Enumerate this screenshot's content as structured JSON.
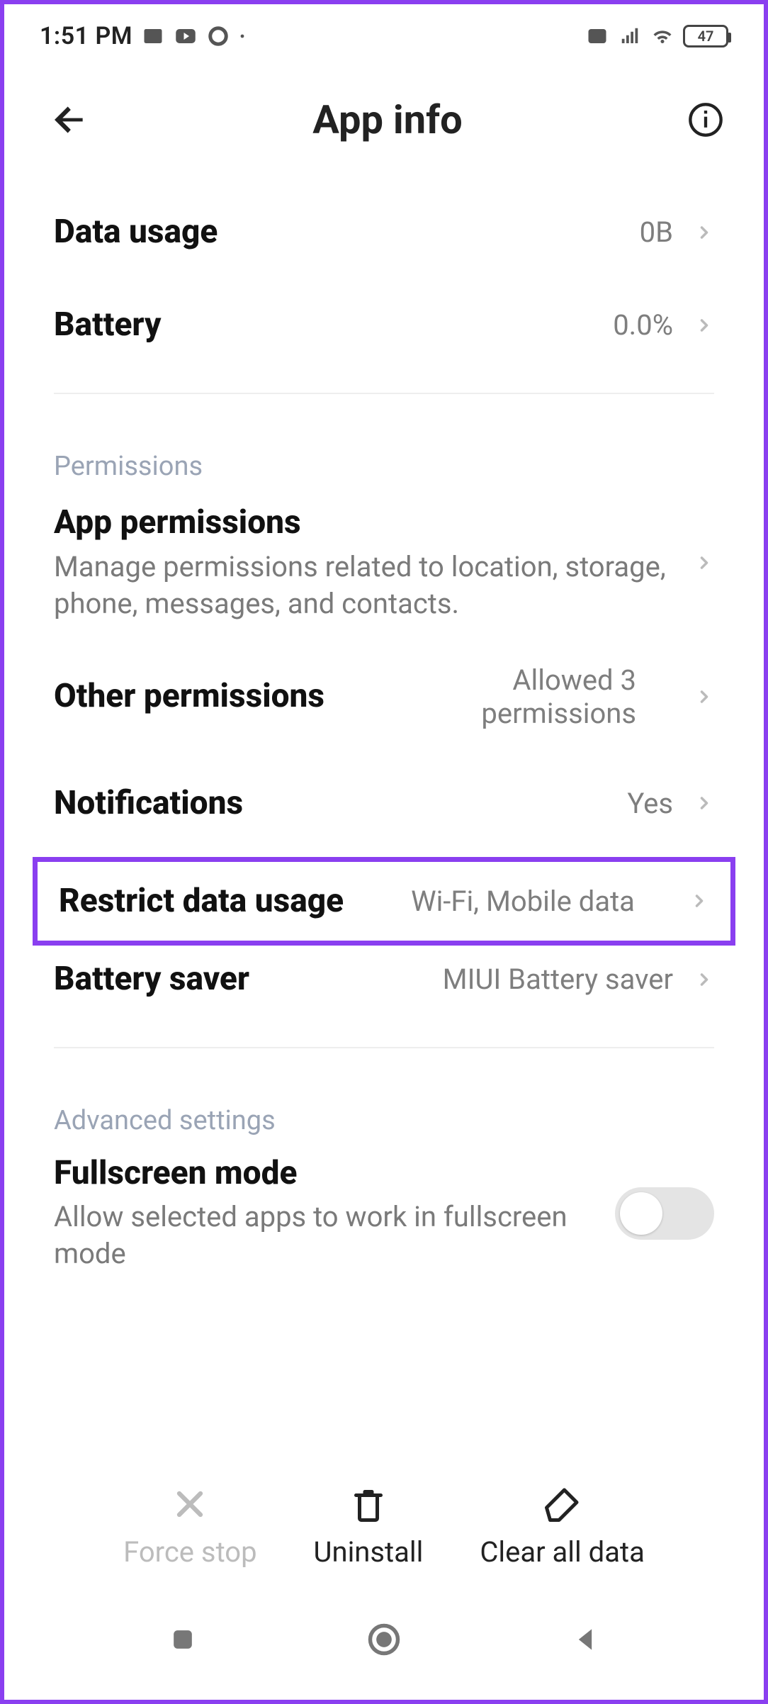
{
  "statusbar": {
    "time": "1:51 PM",
    "battery_level": "47"
  },
  "header": {
    "title": "App info"
  },
  "rows": {
    "data_usage": {
      "label": "Data usage",
      "value": "0B"
    },
    "battery": {
      "label": "Battery",
      "value": "0.0%"
    }
  },
  "sections": {
    "permissions_title": "Permissions",
    "advanced_title": "Advanced settings"
  },
  "permissions": {
    "app_permissions": {
      "label": "App permissions",
      "sub": "Manage permissions related to location, storage, phone, messages, and contacts."
    },
    "other_permissions": {
      "label": "Other permissions",
      "value": "Allowed 3 permissions"
    },
    "notifications": {
      "label": "Notifications",
      "value": "Yes"
    },
    "restrict_data": {
      "label": "Restrict data usage",
      "value": "Wi-Fi, Mobile data"
    },
    "battery_saver": {
      "label": "Battery saver",
      "value": "MIUI Battery saver"
    }
  },
  "advanced": {
    "fullscreen": {
      "label": "Fullscreen mode",
      "sub": "Allow selected apps to work in fullscreen mode"
    }
  },
  "actions": {
    "force_stop": "Force stop",
    "uninstall": "Uninstall",
    "clear_all": "Clear all data"
  }
}
